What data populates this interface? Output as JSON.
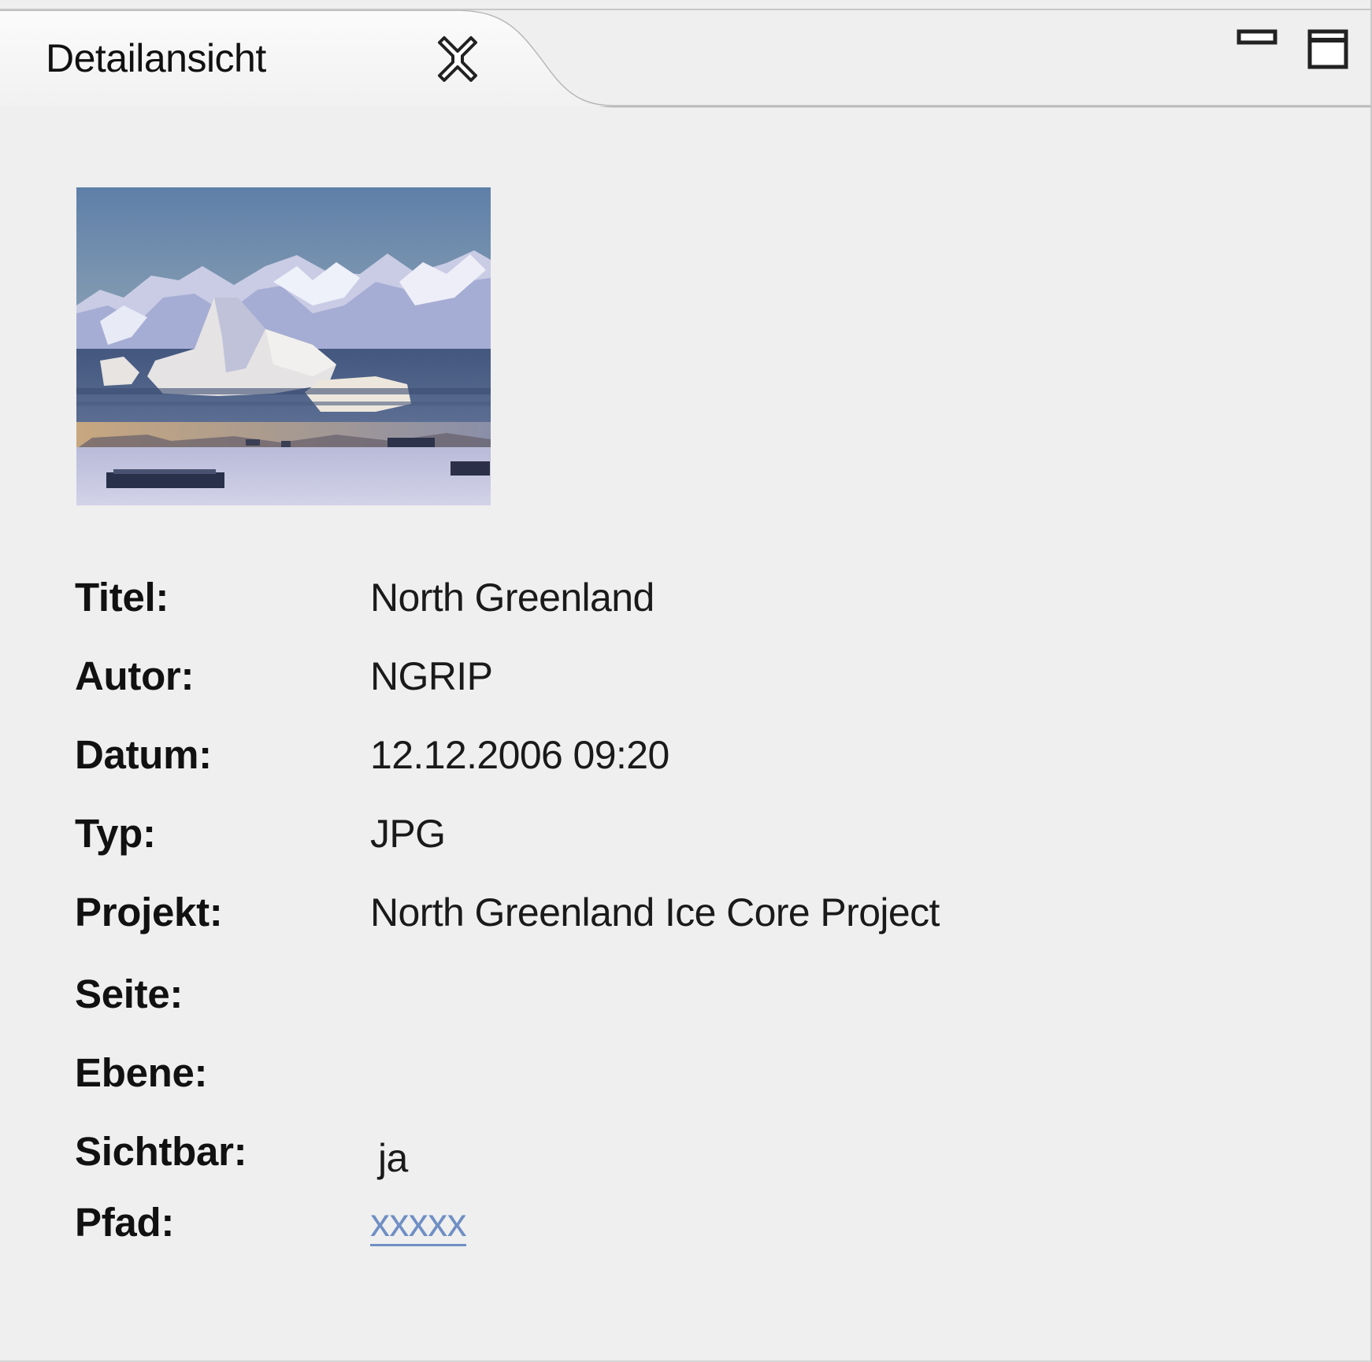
{
  "tab": {
    "title": "Detailansicht",
    "close_icon": "close-icon"
  },
  "window_controls": {
    "minimize_icon": "minimize-icon",
    "maximize_icon": "maximize-icon"
  },
  "preview": {
    "icon": "image-thumbnail"
  },
  "details": {
    "titel": {
      "label": "Titel:",
      "value": "North Greenland"
    },
    "autor": {
      "label": "Autor:",
      "value": "NGRIP"
    },
    "datum": {
      "label": "Datum:",
      "value": "12.12.2006 09:20"
    },
    "typ": {
      "label": "Typ:",
      "value": "JPG"
    },
    "projekt": {
      "label": "Projekt:",
      "value": "North Greenland Ice Core Project"
    },
    "seite": {
      "label": "Seite:",
      "value": ""
    },
    "ebene": {
      "label": "Ebene:",
      "value": ""
    },
    "sichtbar": {
      "label": "Sichtbar:",
      "value": "ja"
    },
    "pfad": {
      "label": "Pfad:",
      "value": "xxxxx"
    }
  },
  "colors": {
    "background": "#efefef",
    "link": "#6f8fc4",
    "text": "#111111"
  }
}
